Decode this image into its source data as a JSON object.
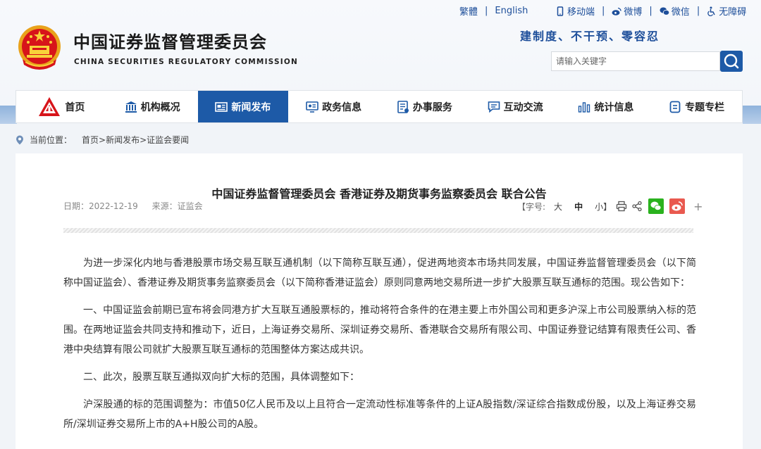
{
  "top_links": {
    "traditional": "繁體",
    "english": "English",
    "mobile": "移动端",
    "weibo": "微博",
    "wechat": "微信",
    "accessibility": "无障碍"
  },
  "site": {
    "name": "中国证券监督管理委员会",
    "name_en": "CHINA SECURITIES REGULATORY COMMISSION",
    "slogan": "建制度、不干预、零容忍"
  },
  "search": {
    "placeholder": "请输入关键字"
  },
  "nav": {
    "items": [
      {
        "label": "首页",
        "icon": "csrc-logo-icon"
      },
      {
        "label": "机构概况",
        "icon": "institution-icon"
      },
      {
        "label": "新闻发布",
        "icon": "news-icon"
      },
      {
        "label": "政务信息",
        "icon": "gov-info-icon"
      },
      {
        "label": "办事服务",
        "icon": "service-icon"
      },
      {
        "label": "互动交流",
        "icon": "chat-icon"
      },
      {
        "label": "统计信息",
        "icon": "stats-icon"
      },
      {
        "label": "专题专栏",
        "icon": "topic-icon"
      }
    ],
    "active_index": 2
  },
  "breadcrumb": {
    "label": "当前位置：",
    "path": "首页>新闻发布>证监会要闻"
  },
  "article": {
    "title": "中国证券监督管理委员会 香港证券及期货事务监察委员会 联合公告",
    "date": "日期：2022-12-19",
    "source": "来源：证监会",
    "font_size_label": "【字号:",
    "font_large": "大",
    "font_medium": "中",
    "font_small": "小】",
    "plus": "+",
    "paragraphs": [
      "为进一步深化内地与香港股票市场交易互联互通机制（以下简称互联互通），促进两地资本市场共同发展，中国证券监督管理委员会（以下简称中国证监会）、香港证券及期货事务监察委员会（以下简称香港证监会）原则同意两地交易所进一步扩大股票互联互通标的范围。现公告如下：",
      "一、中国证监会前期已宣布将会同港方扩大互联互通股票标的，推动将符合条件的在港主要上市外国公司和更多沪深上市公司股票纳入标的范围。在两地证监会共同支持和推动下，近日，上海证券交易所、深圳证券交易所、香港联合交易所有限公司、中国证券登记结算有限责任公司、香港中央结算有限公司就扩大股票互联互通标的范围整体方案达成共识。",
      "二、此次，股票互联互通拟双向扩大标的范围，具体调整如下：",
      "沪深股通的标的范围调整为：市值50亿人民币及以上且符合一定流动性标准等条件的上证A股指数/深证综合指数成份股，以及上海证券交易所/深圳证券交易所上市的A+H股公司的A股。"
    ]
  }
}
